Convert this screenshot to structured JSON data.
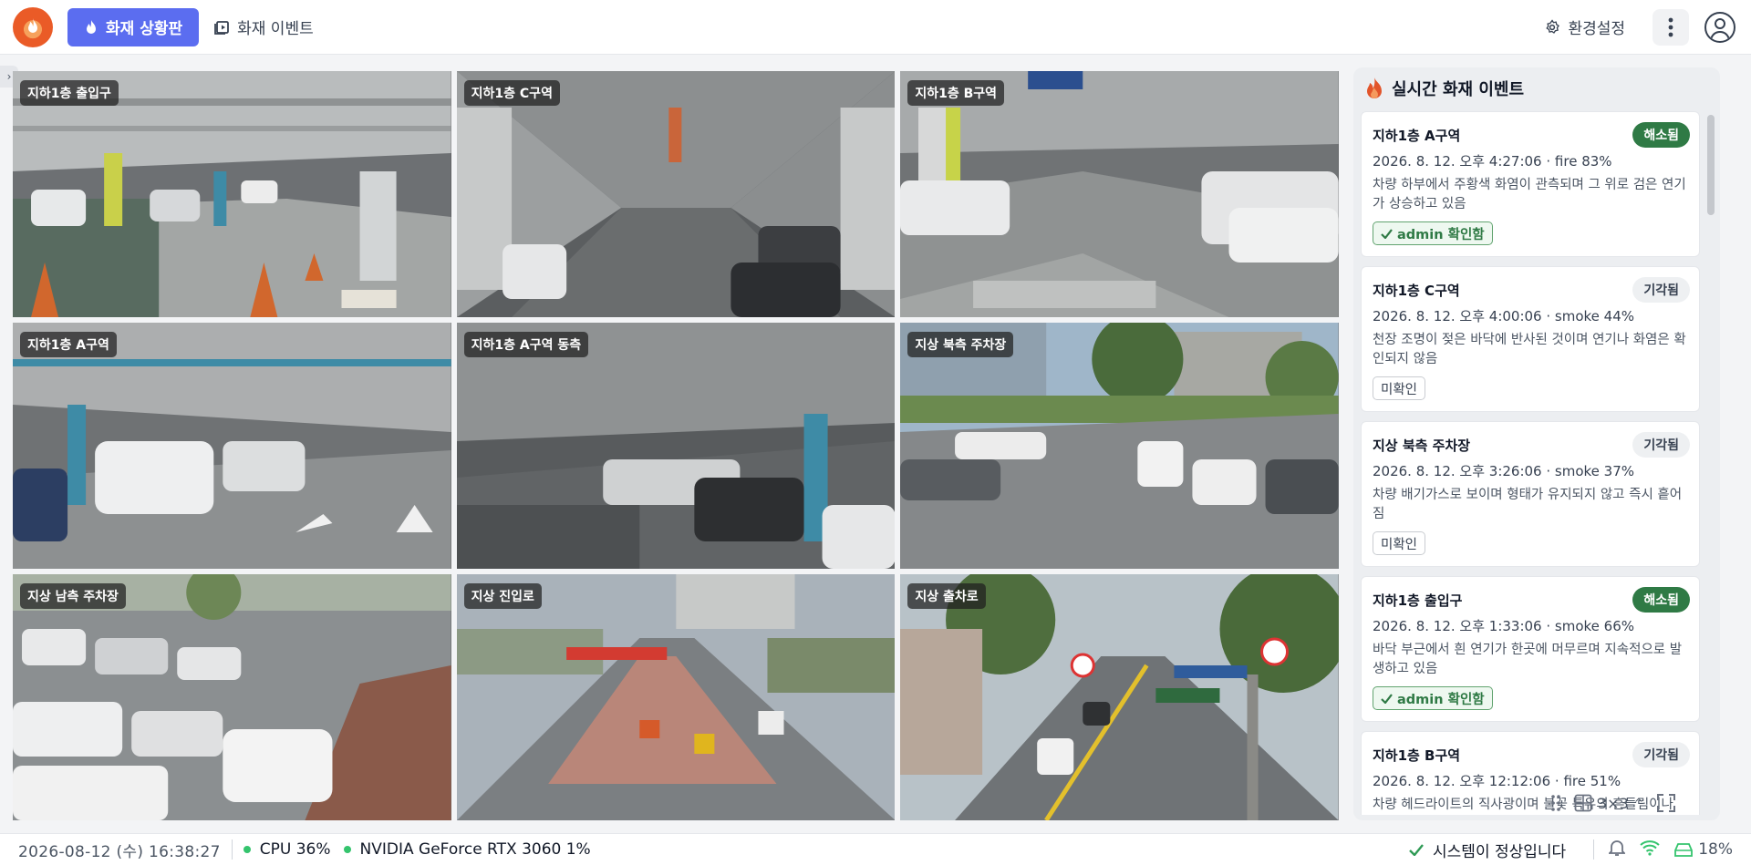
{
  "header": {
    "dashboard_button": "화재 상황판",
    "events_link": "화재 이벤트",
    "settings_label": "환경설정"
  },
  "cameras": [
    {
      "label": "지하1층 출입구"
    },
    {
      "label": "지하1층 C구역"
    },
    {
      "label": "지하1층 B구역"
    },
    {
      "label": "지하1층 A구역"
    },
    {
      "label": "지하1층 A구역 동측"
    },
    {
      "label": "지상 북측 주차장"
    },
    {
      "label": "지상 남측 주차장"
    },
    {
      "label": "지상 진입로"
    },
    {
      "label": "지상 출차로"
    }
  ],
  "events_panel": {
    "title": "실시간 화재 이벤트",
    "events": [
      {
        "location": "지하1층 A구역",
        "status": "해소됨",
        "meta": "2026. 8. 12. 오후 4:27:06 · fire 83%",
        "description": "차량 하부에서 주황색 화염이 관측되며 그 위로 검은 연기가 상승하고 있음",
        "ack": "admin 확인함"
      },
      {
        "location": "지하1층 C구역",
        "status": "기각됨",
        "meta": "2026. 8. 12. 오후 4:00:06 · smoke 44%",
        "description": "천장 조명이 젖은 바닥에 반사된 것이며 연기나 화염은 확인되지 않음",
        "ack": "미확인"
      },
      {
        "location": "지상 북측 주차장",
        "status": "기각됨",
        "meta": "2026. 8. 12. 오후 3:26:06 · smoke 37%",
        "description": "차량 배기가스로 보이며 형태가 유지되지 않고 즉시 흩어짐",
        "ack": "미확인"
      },
      {
        "location": "지하1층 출입구",
        "status": "해소됨",
        "meta": "2026. 8. 12. 오후 1:33:06 · smoke 66%",
        "description": "바닥 부근에서 흰 연기가 한곳에 머무르며 지속적으로 발생하고 있음",
        "ack": "admin 확인함"
      },
      {
        "location": "지하1층 B구역",
        "status": "기각됨",
        "meta": "2026. 8. 12. 오후 12:12:06 · fire 51%",
        "description": "차량 헤드라이트의 직사광이며 불꽃 특유의 흔들림이나 번짐이 없음",
        "ack": ""
      }
    ]
  },
  "layout_control": {
    "grid_label": "3×3"
  },
  "statusbar": {
    "clock": "2026-08-12 (수) 16:38:27",
    "cpu": "CPU 36%",
    "gpu": "NVIDIA GeForce RTX 3060 1%",
    "system_status": "시스템이 정상입니다",
    "storage": "18%"
  },
  "colors": {
    "accent": "#5b6df0",
    "resolved": "#2f7a45",
    "ok_dot": "#34c46d"
  }
}
